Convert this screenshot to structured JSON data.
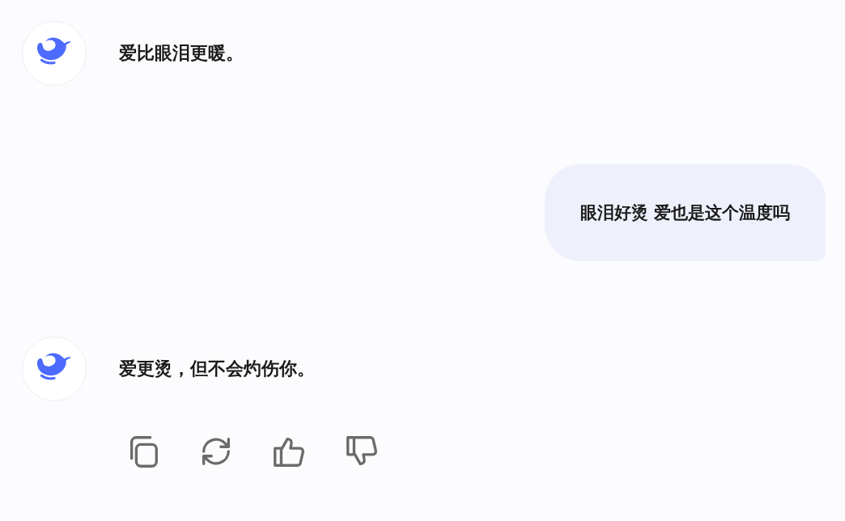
{
  "messages": [
    {
      "kind": "assistant",
      "text": "爱比眼泪更暖。"
    },
    {
      "kind": "user",
      "text": "眼泪好烫 爱也是这个温度吗"
    },
    {
      "kind": "assistant",
      "text": "爱更烫，但不会灼伤你。"
    }
  ],
  "actions": [
    {
      "kind": "copy"
    },
    {
      "kind": "regenerate"
    },
    {
      "kind": "like"
    },
    {
      "kind": "dislike"
    }
  ]
}
